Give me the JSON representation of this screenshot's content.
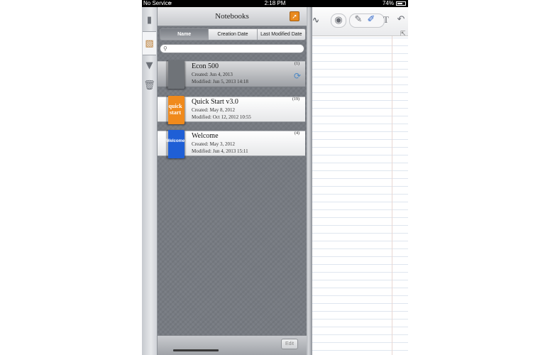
{
  "status_bar": {
    "carrier": "No Service",
    "time": "2:18 PM",
    "battery_text": "74%",
    "battery_level": 0.74
  },
  "panel": {
    "title": "Notebooks",
    "edit_label": "Edit"
  },
  "sort_tabs": [
    "Name",
    "Creation Date",
    "Last Modified Date"
  ],
  "search": {
    "placeholder": ""
  },
  "notebooks": [
    {
      "title": "Econ 500",
      "created": "Created: Jun 4, 2013",
      "modified": "Modified: Jun 5, 2013 14:18",
      "count": "(1)",
      "cover_color": "#6f7378"
    },
    {
      "title": "Quick Start v3.0",
      "created": "Created: May 8, 2012",
      "modified": "Modified: Oct 12, 2012 10:55",
      "count": "(19)",
      "cover_color": "#f08a1c",
      "cover_text": "quick start"
    },
    {
      "title": "Welcome",
      "created": "Created: May 3, 2012",
      "modified": "Modified: Jun 4, 2013 15:11",
      "count": "(4)",
      "cover_color": "#1f5fd6",
      "cover_text": "Welcome"
    }
  ],
  "toolbar": {
    "text_tool": "T"
  },
  "icons": [
    "wifi-icon",
    "battery-icon",
    "notebook-tab-icon",
    "notebooks-icon",
    "pen-nib-icon",
    "trash-icon",
    "export-icon",
    "search-icon",
    "sync-icon",
    "pen-tool-icon",
    "eraser-icon",
    "highlighter-icon",
    "text-icon",
    "undo-icon",
    "resize-icon"
  ]
}
